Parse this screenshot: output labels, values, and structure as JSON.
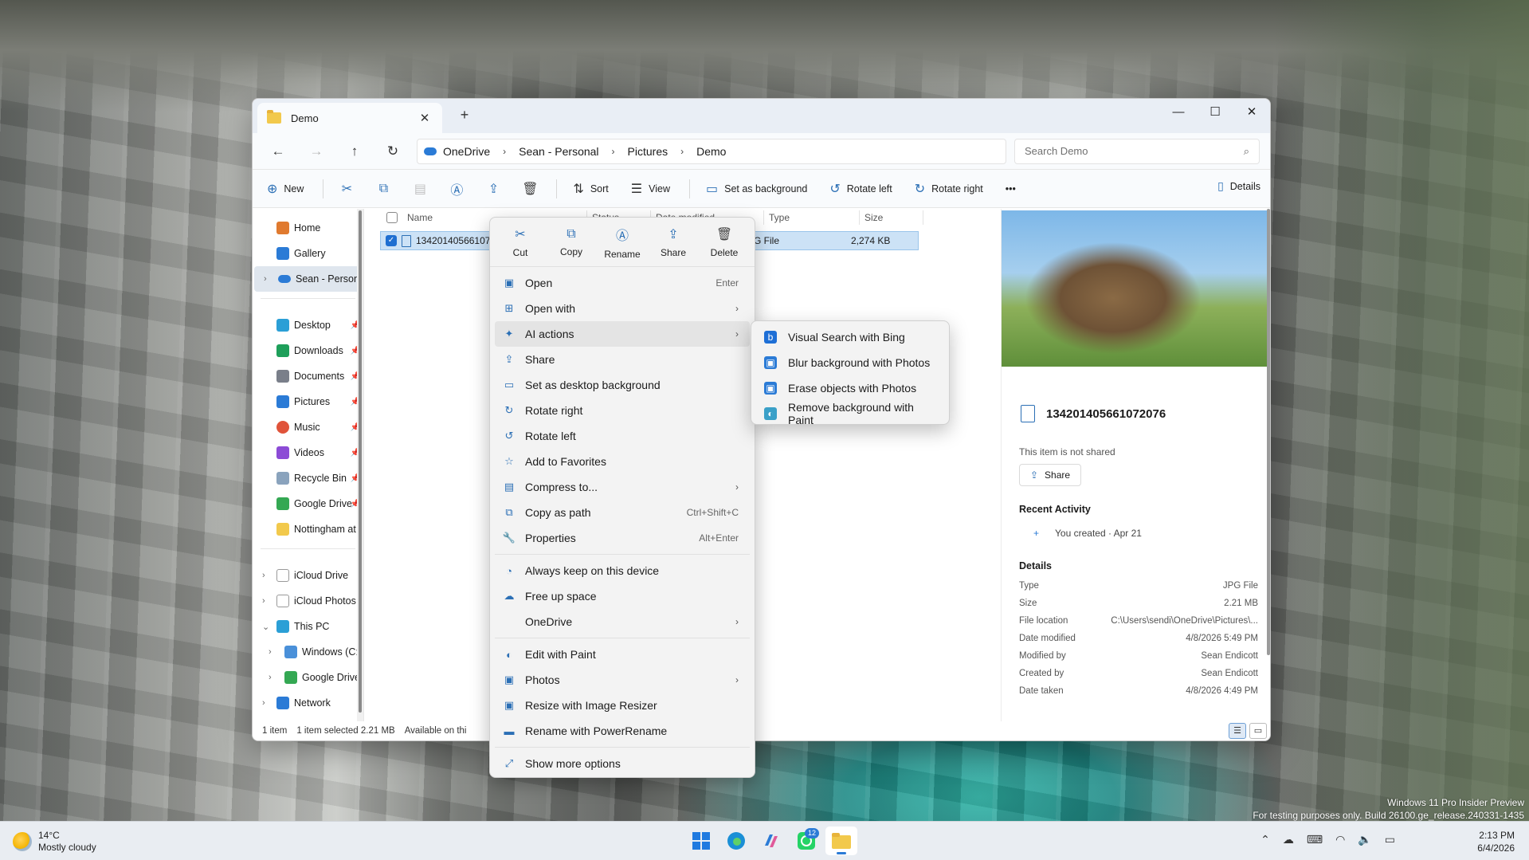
{
  "window": {
    "tab_title": "Demo",
    "new_tab": "+",
    "controls": [
      "—",
      "☐",
      "✕"
    ]
  },
  "address": {
    "crumbs": [
      "OneDrive",
      "Sean - Personal",
      "Pictures",
      "Demo"
    ],
    "search_placeholder": "Search Demo"
  },
  "toolbar": {
    "new": "New",
    "sort": "Sort",
    "view": "View",
    "set_bg": "Set as background",
    "rotate_left": "Rotate left",
    "rotate_right": "Rotate right",
    "more": "•••",
    "details": "Details"
  },
  "nav": {
    "items": [
      {
        "label": "Home",
        "color": "#e07a2f"
      },
      {
        "label": "Gallery",
        "color": "#2b7bd6"
      },
      {
        "label": "Sean - Personal",
        "color": "#2b7bd6"
      },
      {
        "label": "Desktop",
        "color": "#2b9fd6"
      },
      {
        "label": "Downloads",
        "color": "#1e9f5a"
      },
      {
        "label": "Documents",
        "color": "#7a7f8a"
      },
      {
        "label": "Pictures",
        "color": "#2b7bd6"
      },
      {
        "label": "Music",
        "color": "#e0533a"
      },
      {
        "label": "Videos",
        "color": "#8c4bd6"
      },
      {
        "label": "Recycle Bin",
        "color": "#8aa3bd"
      },
      {
        "label": "Google Drive",
        "color": "#34a853"
      },
      {
        "label": "Nottingham at (",
        "color": "#f2c94c"
      },
      {
        "label": "iCloud Drive",
        "color": "#ffffff"
      },
      {
        "label": "iCloud Photos",
        "color": "#ffffff"
      },
      {
        "label": "This PC",
        "color": "#2b9fd6"
      },
      {
        "label": "Windows  (C:)",
        "color": "#4a90d9"
      },
      {
        "label": "Google Drive (",
        "color": "#34a853"
      },
      {
        "label": "Network",
        "color": "#2b7bd6"
      }
    ]
  },
  "columns": {
    "name": "Name",
    "status": "Status",
    "date": "Date modified",
    "type": "Type",
    "size": "Size"
  },
  "file": {
    "name": "134201405661072",
    "type": "JPG File",
    "size": "2,274 KB"
  },
  "context": {
    "quick": [
      "Cut",
      "Copy",
      "Rename",
      "Share",
      "Delete"
    ],
    "items": [
      {
        "label": "Open",
        "shortcut": "Enter",
        "icon": "▣"
      },
      {
        "label": "Open with",
        "arrow": "›",
        "icon": "⊞"
      },
      {
        "label": "AI actions",
        "arrow": "›",
        "icon": "✦"
      },
      {
        "label": "Share",
        "icon": "⇪"
      },
      {
        "label": "Set as desktop background",
        "icon": "▭"
      },
      {
        "label": "Rotate right",
        "icon": "↻"
      },
      {
        "label": "Rotate left",
        "icon": "↺"
      },
      {
        "label": "Add to Favorites",
        "icon": "☆"
      },
      {
        "label": "Compress to...",
        "arrow": "›",
        "icon": "▤"
      },
      {
        "label": "Copy as path",
        "shortcut": "Ctrl+Shift+C",
        "icon": "⧉"
      },
      {
        "label": "Properties",
        "shortcut": "Alt+Enter",
        "icon": "🔧"
      },
      {
        "label": "Always keep on this device",
        "icon": "◔"
      },
      {
        "label": "Free up space",
        "icon": "☁"
      },
      {
        "label": "OneDrive",
        "arrow": "›",
        "icon": ""
      },
      {
        "label": "Edit with Paint",
        "icon": "◐"
      },
      {
        "label": "Photos",
        "arrow": "›",
        "icon": "▣"
      },
      {
        "label": "Resize with Image Resizer",
        "icon": "▣"
      },
      {
        "label": "Rename with PowerRename",
        "icon": "▬"
      },
      {
        "label": "Show more options",
        "icon": "⤢"
      }
    ]
  },
  "ai_submenu": [
    {
      "label": "Visual Search with Bing",
      "icon": "b",
      "color": "#1e6fd6"
    },
    {
      "label": "Blur background with Photos",
      "icon": "▣",
      "color": "#2b7bd6"
    },
    {
      "label": "Erase objects with Photos",
      "icon": "▣",
      "color": "#2b7bd6"
    },
    {
      "label": "Remove background with Paint",
      "icon": "◐",
      "color": "#3aa0c8"
    }
  ],
  "details": {
    "filename": "134201405661072076",
    "not_shared": "This item is not shared",
    "share": "Share",
    "recent_activity": "Recent Activity",
    "activity_plus": "+",
    "activity": "You created · Apr 21",
    "details_heading": "Details",
    "props": [
      {
        "k": "Type",
        "v": "JPG File"
      },
      {
        "k": "Size",
        "v": "2.21 MB"
      },
      {
        "k": "File location",
        "v": "C:\\Users\\sendi\\OneDrive\\Pictures\\..."
      },
      {
        "k": "Date modified",
        "v": "4/8/2026 5:49 PM"
      },
      {
        "k": "Modified by",
        "v": "Sean Endicott"
      },
      {
        "k": "Created by",
        "v": "Sean Endicott"
      },
      {
        "k": "Date taken",
        "v": "4/8/2026 4:49 PM"
      }
    ]
  },
  "status": {
    "count": "1 item",
    "selected": "1 item selected  2.21 MB",
    "availability": "Available on thi"
  },
  "watermark": {
    "line1": "Windows 11 Pro Insider Preview",
    "line2": "For testing purposes only. Build 26100.ge_release.240331-1435"
  },
  "taskbar": {
    "temp": "14°C",
    "weather": "Mostly cloudy",
    "badge": "12",
    "time": "2:13 PM",
    "date": "6/4/2026"
  }
}
